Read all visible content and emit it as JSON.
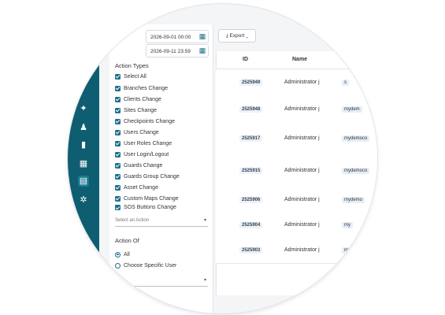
{
  "filters": {
    "date_from": "2026-09-01 00:00",
    "date_to": "2026-09-11 23:59",
    "action_types_title": "Action Types",
    "action_types": [
      "Select All",
      "Branches Change",
      "Clients Change",
      "Sites Change",
      "Checkpoints Change",
      "Users Change",
      "User Roles Change",
      "User Login/Logout",
      "Guards Change",
      "Guards Group Change",
      "Asset Change",
      "Custom Maps Change",
      "SOS Buttons Change"
    ],
    "select_action_placeholder": "Select an Action",
    "action_of_title": "Action Of",
    "action_of_options": [
      "All",
      "Choose Specific User"
    ],
    "action_of_selected": "All"
  },
  "toolbar": {
    "export_label": "Export"
  },
  "table": {
    "columns": [
      "ID",
      "Name"
    ],
    "rows": [
      {
        "id": "2525949",
        "name": "Administrator j",
        "tag": "s"
      },
      {
        "id": "2525948",
        "name": "Administrator j",
        "tag": "mydem"
      },
      {
        "id": "2525917",
        "name": "Administrator j",
        "tag": "mydemoco"
      },
      {
        "id": "2525915",
        "name": "Administrator j",
        "tag": "mydemoco"
      },
      {
        "id": "2525906",
        "name": "Administrator j",
        "tag": "mydemo"
      },
      {
        "id": "2525904",
        "name": "Administrator j",
        "tag": "my"
      },
      {
        "id": "2525903",
        "name": "Administrator j",
        "tag": "mydemoco"
      }
    ]
  },
  "icons": {
    "nav": [
      "pin-icon",
      "person-icon",
      "bar-chart-icon",
      "image-chart-icon",
      "document-icon",
      "settings-icon"
    ],
    "calendar": "calendar-icon",
    "export": "download-icon"
  },
  "colors": {
    "sidebar": "#0e5d70",
    "checkbox": "#1e6f8c",
    "tag_bg": "#e5eef8"
  }
}
